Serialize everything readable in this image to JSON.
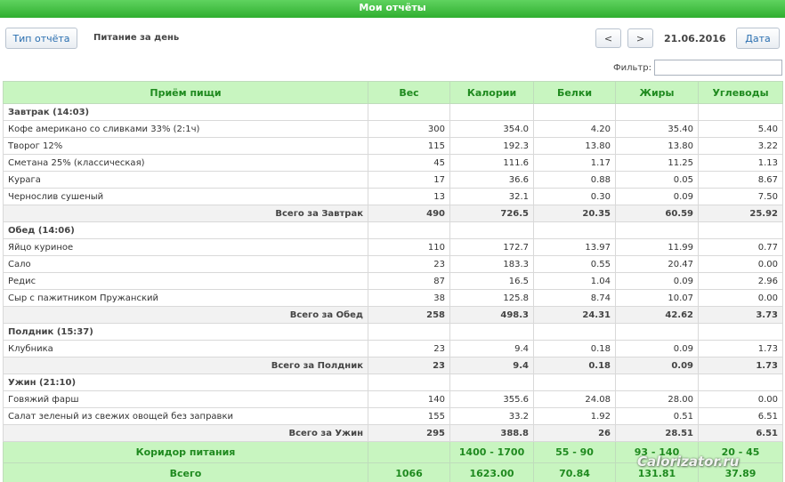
{
  "header": {
    "title": "Мои отчёты"
  },
  "toolbar": {
    "report_type_label": "Тип отчёта",
    "report_name": "Питание за день",
    "prev_label": "<",
    "next_label": ">",
    "date": "21.06.2016",
    "date_button_label": "Дата"
  },
  "filter": {
    "label": "Фильтр:",
    "value": "",
    "placeholder": ""
  },
  "table": {
    "columns": [
      "Приём пищи",
      "Вес",
      "Калории",
      "Белки",
      "Жиры",
      "Углеводы"
    ],
    "meals": [
      {
        "title": "Завтрак (14:03)",
        "items": [
          [
            "Кофе американо со сливками 33% (2:1ч)",
            "300",
            "354.0",
            "4.20",
            "35.40",
            "5.40"
          ],
          [
            "Творог 12%",
            "115",
            "192.3",
            "13.80",
            "13.80",
            "3.22"
          ],
          [
            "Сметана 25% (классическая)",
            "45",
            "111.6",
            "1.17",
            "11.25",
            "1.13"
          ],
          [
            "Курага",
            "17",
            "36.6",
            "0.88",
            "0.05",
            "8.67"
          ],
          [
            "Чернослив сушеный",
            "13",
            "32.1",
            "0.30",
            "0.09",
            "7.50"
          ]
        ],
        "total": [
          "Всего за Завтрак",
          "490",
          "726.5",
          "20.35",
          "60.59",
          "25.92"
        ]
      },
      {
        "title": "Обед (14:06)",
        "items": [
          [
            "Яйцо куриное",
            "110",
            "172.7",
            "13.97",
            "11.99",
            "0.77"
          ],
          [
            "Сало",
            "23",
            "183.3",
            "0.55",
            "20.47",
            "0.00"
          ],
          [
            "Редис",
            "87",
            "16.5",
            "1.04",
            "0.09",
            "2.96"
          ],
          [
            "Сыр с пажитником Пружанский",
            "38",
            "125.8",
            "8.74",
            "10.07",
            "0.00"
          ]
        ],
        "total": [
          "Всего за Обед",
          "258",
          "498.3",
          "24.31",
          "42.62",
          "3.73"
        ]
      },
      {
        "title": "Полдник (15:37)",
        "items": [
          [
            "Клубника",
            "23",
            "9.4",
            "0.18",
            "0.09",
            "1.73"
          ]
        ],
        "total": [
          "Всего за Полдник",
          "23",
          "9.4",
          "0.18",
          "0.09",
          "1.73"
        ]
      },
      {
        "title": "Ужин (21:10)",
        "items": [
          [
            "Говяжий фарш",
            "140",
            "355.6",
            "24.08",
            "28.00",
            "0.00"
          ],
          [
            "Салат зеленый из свежих овощей без заправки",
            "155",
            "33.2",
            "1.92",
            "0.51",
            "6.51"
          ]
        ],
        "total": [
          "Всего за Ужин",
          "295",
          "388.8",
          "26",
          "28.51",
          "6.51"
        ]
      }
    ],
    "corridor": [
      "Коридор питания",
      "",
      "1400 - 1700",
      "55 - 90",
      "93 - 140",
      "20 - 45"
    ],
    "grand_total": [
      "Всего",
      "1066",
      "1623.00",
      "70.84",
      "131.81",
      "37.89"
    ]
  },
  "watermark": "Calorizator.ru"
}
